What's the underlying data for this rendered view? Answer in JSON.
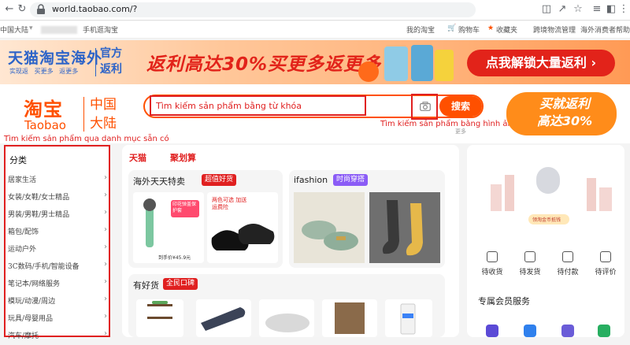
{
  "browser": {
    "url": "world.taobao.com/?"
  },
  "topbar": {
    "region": "中国大陆",
    "mobile_taobao": "手机逛淘宝",
    "my_taobao": "我的淘宝",
    "cart": "购物车",
    "favorites": "收藏夹",
    "cross_border": "跨境物流管理",
    "consumer_help": "海外消费者帮助"
  },
  "banner": {
    "brand": "天猫淘宝海外",
    "official_line1": "官方",
    "official_line2": "返利",
    "sub1": "实现返",
    "sub2": "买更多",
    "sub3": "返更多",
    "promo": "返利高达30%买更多返更多",
    "cta": "点我解锁大量返利 ›"
  },
  "header": {
    "logo_cn": "淘宝",
    "logo_en": "Taobao",
    "region_line1": "中国",
    "region_line2": "大陆",
    "search_placeholder": "Tìm kiếm sản phẩm bằng từ khóa",
    "search_button": "搜索",
    "image_search_label": "Tìm kiếm sản phẩm bằng hình ảnh",
    "more": "更多",
    "category_annotation": "Tìm kiếm sản phẩm qua danh mục sẵn có",
    "cashback_line1": "买就返利",
    "cashback_line2": "高达30%"
  },
  "sidebar": {
    "title": "分类",
    "items": [
      {
        "label": "居家生活"
      },
      {
        "label": "女装/女鞋/女士精品"
      },
      {
        "label": "男装/男鞋/男士精品"
      },
      {
        "label": "箱包/配饰"
      },
      {
        "label": "运动户外"
      },
      {
        "label": "3C数码/手机/智能设备"
      },
      {
        "label": "笔记本/网络服务"
      },
      {
        "label": "模玩/动漫/周边"
      },
      {
        "label": "玩具/母婴用品"
      },
      {
        "label": "汽车/摩托"
      }
    ]
  },
  "main": {
    "tab1": "天猫",
    "tab2": "聚划算",
    "card1_title": "海外天天特卖",
    "card1_badge": "超值好货",
    "card2_title": "ifashion",
    "card2_badge": "时尚穿搭",
    "card3_title": "有好货",
    "card3_badge": "全民口碑",
    "mic_price_tag": "到手价¥45.9元",
    "mic_badge": "印花弹盖保护套",
    "shoe_badge": "两色可选 加送运费险"
  },
  "rpanel": {
    "coin_label": "领淘金币抵钱",
    "actions": [
      {
        "label": "待收货"
      },
      {
        "label": "待发货"
      },
      {
        "label": "待付款"
      },
      {
        "label": "待评价"
      }
    ],
    "member_title": "专属会员服务"
  },
  "colors": {
    "brand_orange": "#ff5000",
    "annotation_red": "#e02020",
    "banner_blue": "#2d64c8"
  }
}
